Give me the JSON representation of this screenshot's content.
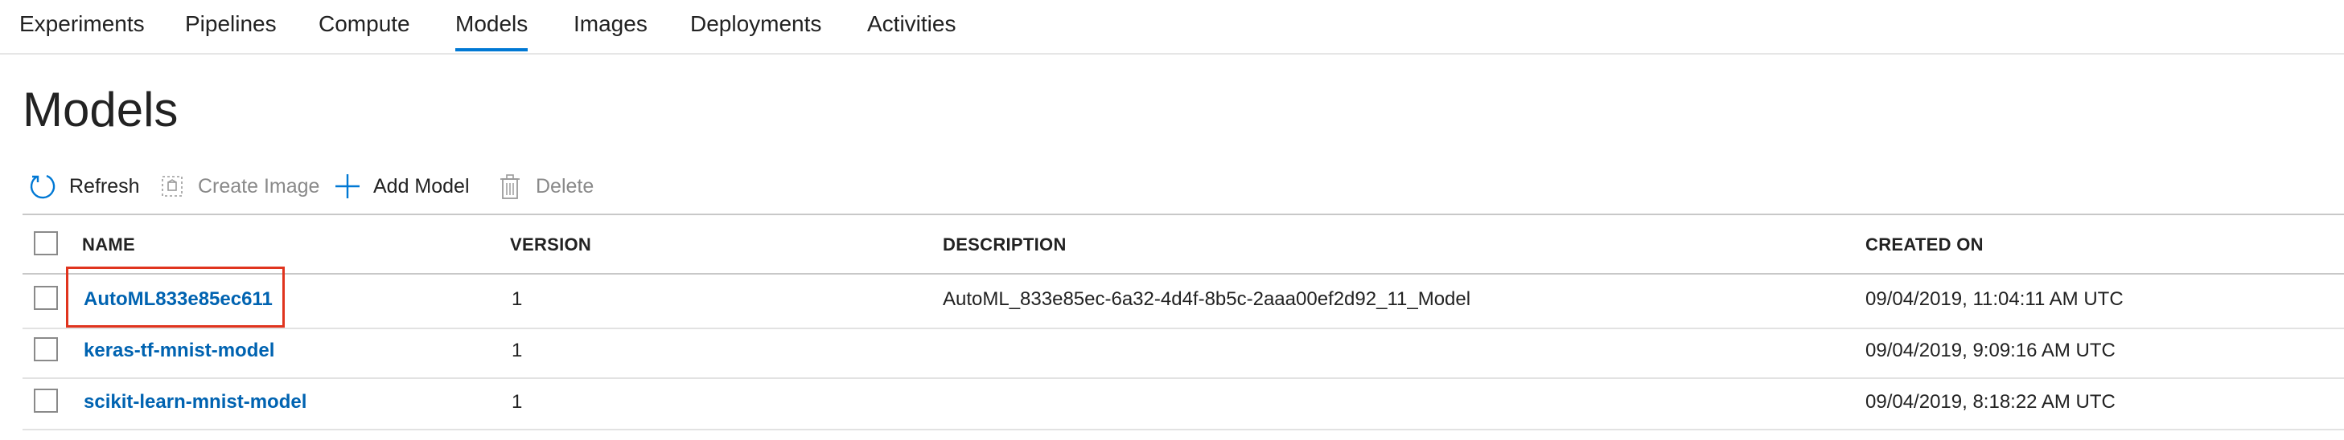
{
  "nav": {
    "tabs": [
      {
        "label": "Experiments"
      },
      {
        "label": "Pipelines"
      },
      {
        "label": "Compute"
      },
      {
        "label": "Models",
        "active": true
      },
      {
        "label": "Images"
      },
      {
        "label": "Deployments"
      },
      {
        "label": "Activities"
      }
    ]
  },
  "page": {
    "title": "Models"
  },
  "toolbar": {
    "refresh": "Refresh",
    "create_image": "Create Image",
    "add_model": "Add Model",
    "delete": "Delete"
  },
  "table": {
    "columns": [
      "NAME",
      "VERSION",
      "DESCRIPTION",
      "CREATED ON"
    ],
    "rows": [
      {
        "name": "AutoML833e85ec611",
        "version": "1",
        "description": "AutoML_833e85ec-6a32-4d4f-8b5c-2aaa00ef2d92_11_Model",
        "created_on": "09/04/2019, 11:04:11 AM UTC"
      },
      {
        "name": "keras-tf-mnist-model",
        "version": "1",
        "description": "",
        "created_on": "09/04/2019, 9:09:16 AM UTC"
      },
      {
        "name": "scikit-learn-mnist-model",
        "version": "1",
        "description": "",
        "created_on": "09/04/2019, 8:18:22 AM UTC"
      }
    ]
  },
  "colors": {
    "accent": "#0078d4",
    "link": "#0063b1",
    "highlight": "#e0341e"
  },
  "icons": {
    "refresh": "refresh-icon",
    "create_image": "create-image-icon",
    "add_model": "plus-icon",
    "delete": "trash-icon"
  }
}
